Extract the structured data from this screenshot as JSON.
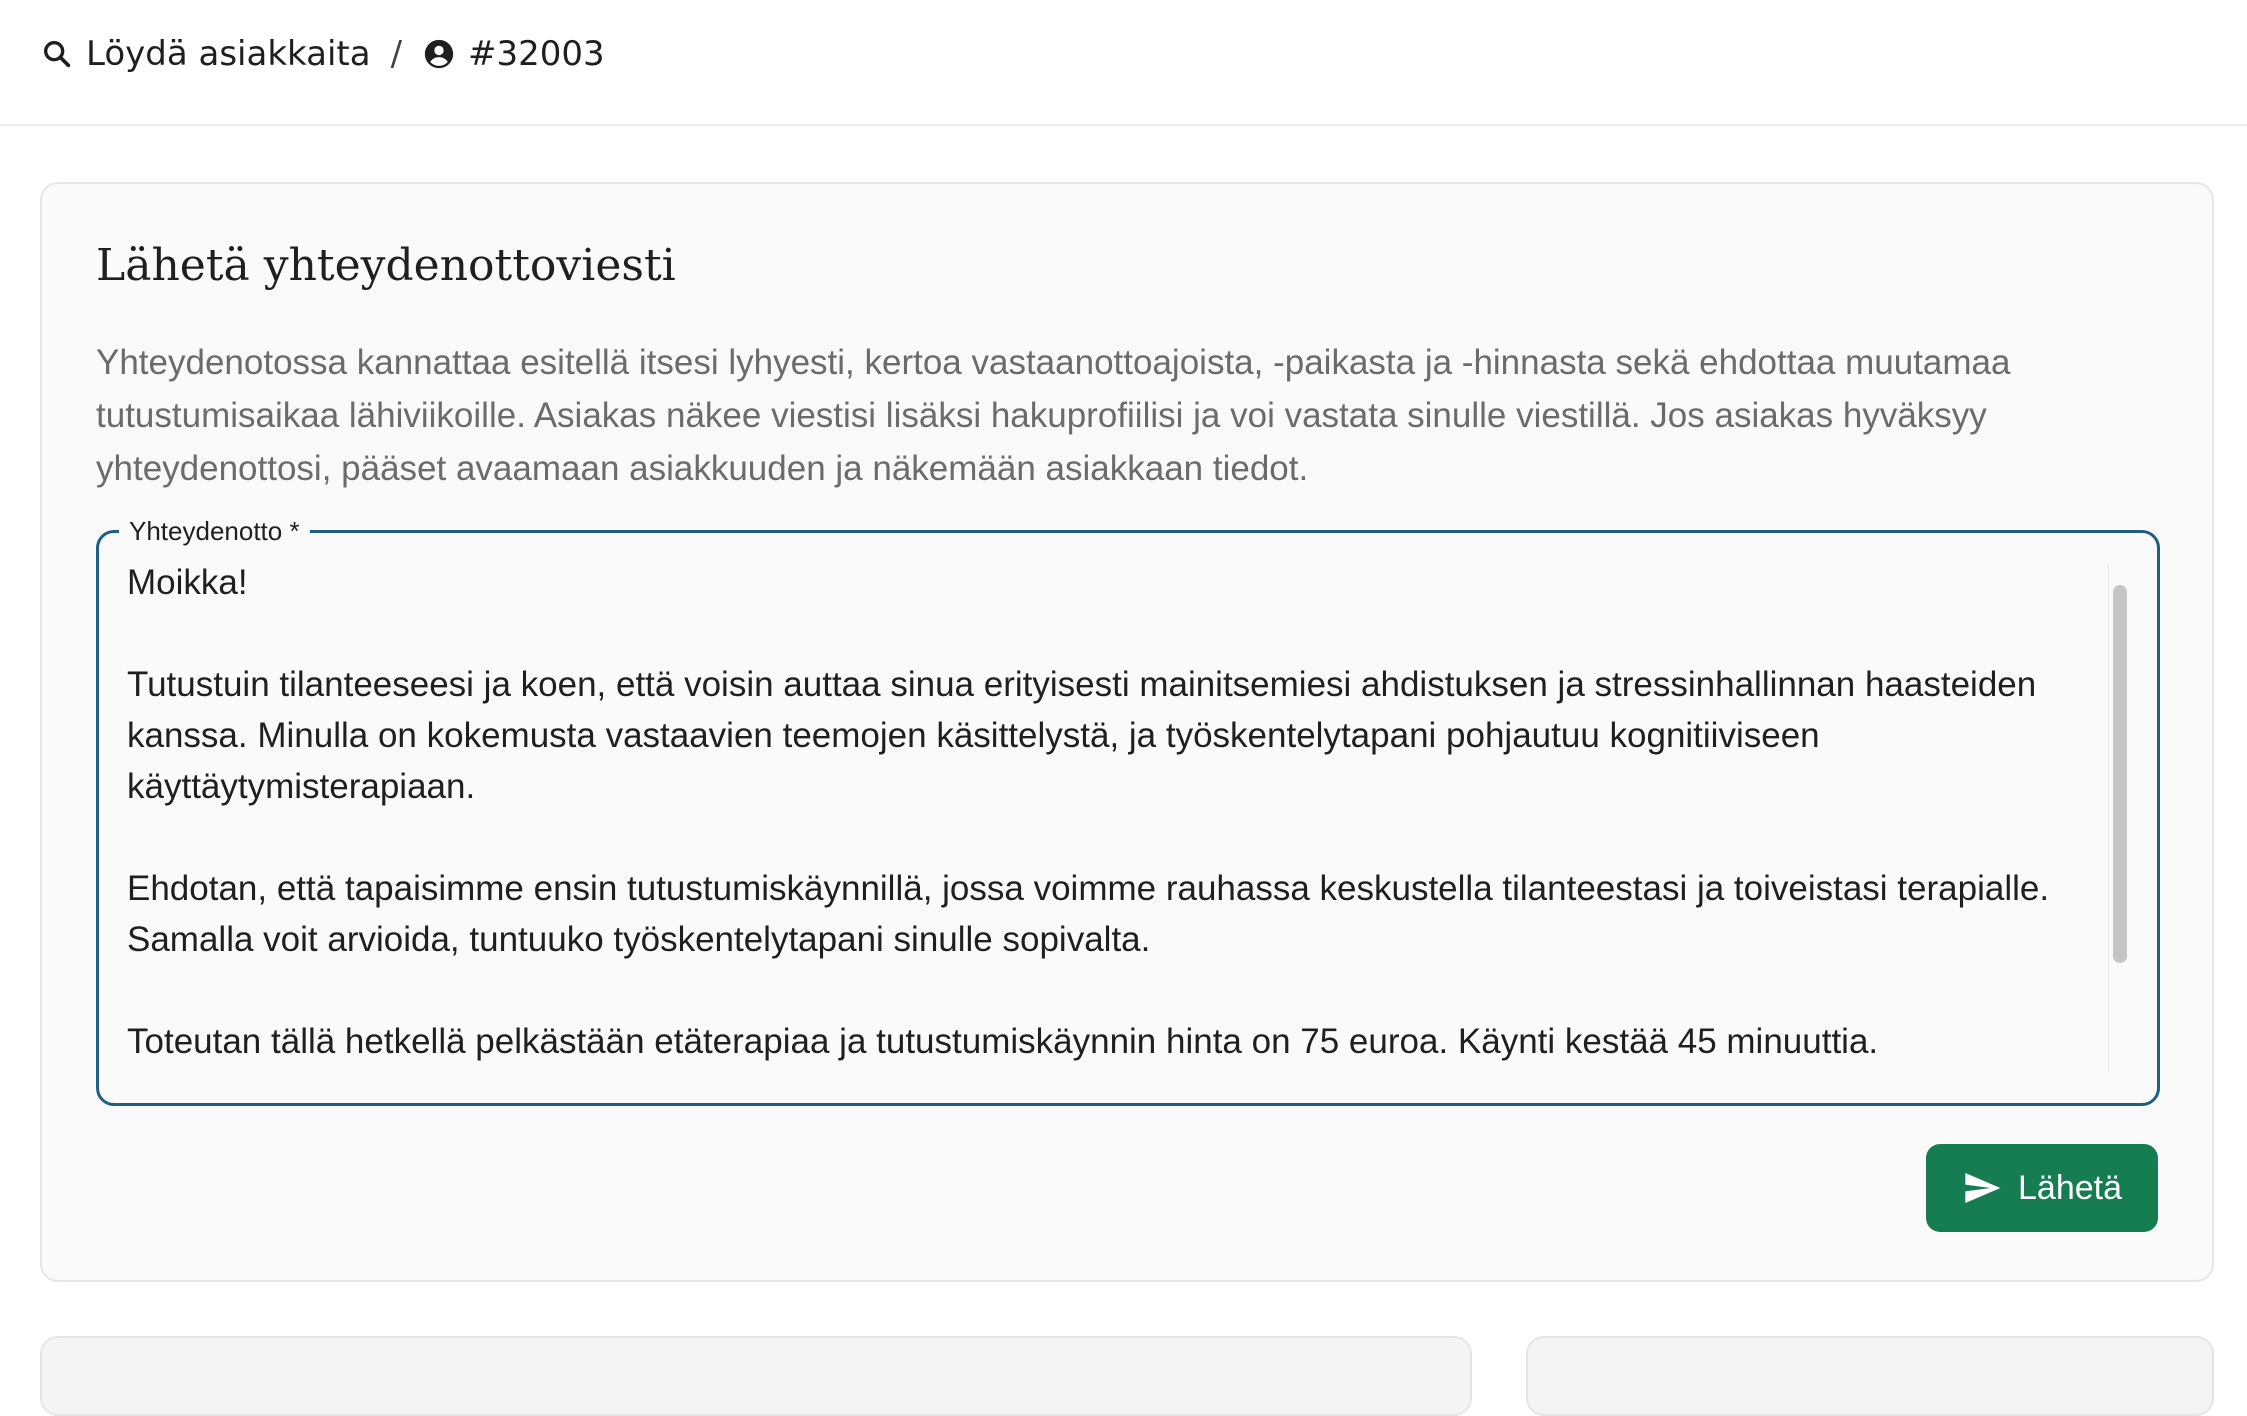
{
  "breadcrumb": {
    "search_label": "Löydä asiakkaita",
    "separator": "/",
    "client_id": "#32003"
  },
  "card": {
    "title": "Lähetä yhteydenottoviesti",
    "description": "Yhteydenotossa kannattaa esitellä itsesi lyhyesti, kertoa vastaanottoajoista, -paikasta ja -hinnasta sekä ehdottaa muutamaa tutustumisaikaa lähiviikoille. Asiakas näkee viestisi lisäksi hakuprofiilisi ja voi vastata sinulle viestillä. Jos asiakas hyväksyy yhteydenottosi, pääset avaamaan asiakkuuden ja näkemään asiakkaan tiedot.",
    "field_label": "Yhteydenotto *",
    "message": "Moikka!\n\nTutustuin tilanteeseesi ja koen, että voisin auttaa sinua erityisesti mainitsemiesi ahdistuksen ja stressinhallinnan haasteiden kanssa. Minulla on kokemusta vastaavien teemojen käsittelystä, ja työskentelytapani pohjautuu kognitiiviseen käyttäytymisterapiaan.\n\nEhdotan, että tapaisimme ensin tutustumiskäynnillä, jossa voimme rauhassa keskustella tilanteestasi ja toiveistasi terapialle. Samalla voit arvioida, tuntuuko työskentelytapani sinulle sopivalta.\n\nToteutan tällä hetkellä pelkästään etäterapiaa ja tutustumiskäynnin hinta on 75 euroa. Käynti kestää 45 minuuttia.",
    "send_label": "Lähetä"
  },
  "icons": {
    "search": "search-icon",
    "client": "account-circle-icon",
    "send": "send-icon"
  },
  "colors": {
    "accent_border": "#1f5f85",
    "send_button": "#167d52"
  }
}
